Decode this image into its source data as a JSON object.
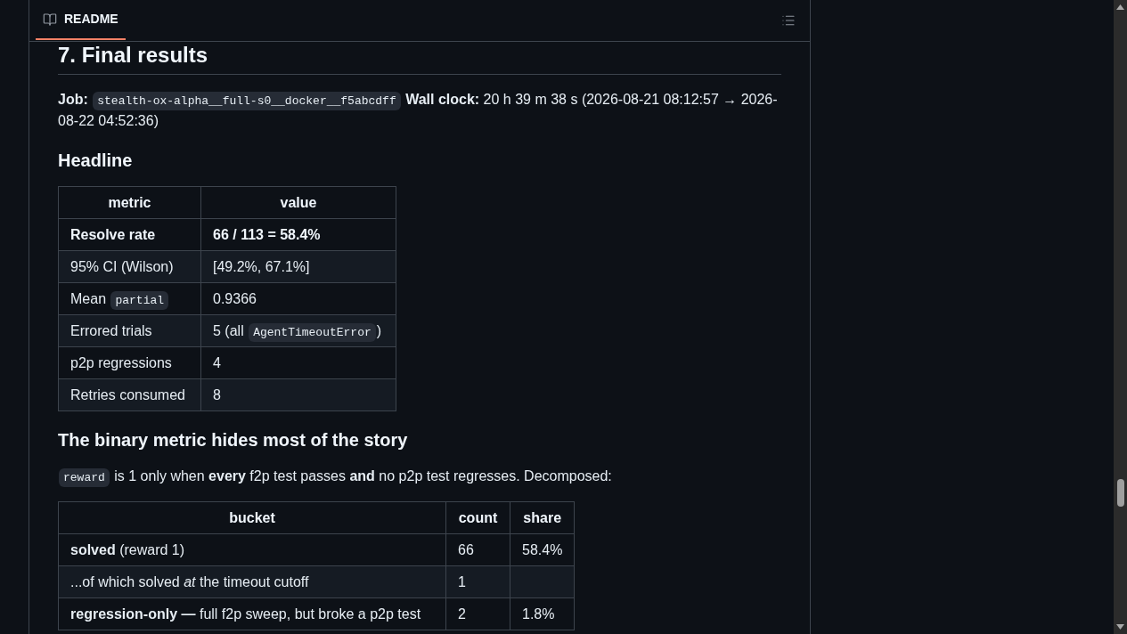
{
  "panel_header": {
    "tabs": [
      {
        "label": "README",
        "selected": true
      }
    ]
  },
  "content": [
    {
      "kind": "h2",
      "text": "7. Final results"
    },
    {
      "kind": "paragraph",
      "segments": [
        {
          "kind": "text",
          "text": "**Job:** "
        },
        {
          "kind": "code",
          "text": "stealth-ox-alpha__full-s0__docker__f5abcdff"
        },
        {
          "kind": "text",
          "text": " **Wall clock:** 20 h 39 m 38 s (2026-08-21 08:12:57 → 2026-08-22 04:52:36)"
        }
      ]
    },
    {
      "kind": "h3",
      "text": "Headline"
    },
    {
      "kind": "table",
      "columns": [
        {
          "label": "metric"
        },
        {
          "label": "value"
        }
      ],
      "rows": [
        {
          "bold": true,
          "cells": [
            [
              {
                "kind": "text",
                "text": "Resolve rate"
              }
            ],
            [
              {
                "kind": "text",
                "text": "66 / 113 = 58.4%"
              }
            ]
          ]
        },
        {
          "bold": false,
          "cells": [
            [
              {
                "kind": "text",
                "text": "95% CI (Wilson)"
              }
            ],
            [
              {
                "kind": "text",
                "text": "[49.2%, 67.1%]"
              }
            ]
          ]
        },
        {
          "bold": false,
          "cells": [
            [
              {
                "kind": "text",
                "text": "Mean "
              },
              {
                "kind": "code",
                "text": "partial"
              }
            ],
            [
              {
                "kind": "text",
                "text": "0.9366"
              }
            ]
          ]
        },
        {
          "bold": false,
          "cells": [
            [
              {
                "kind": "text",
                "text": "Errored trials"
              }
            ],
            [
              {
                "kind": "text",
                "text": "5 (all "
              },
              {
                "kind": "code",
                "text": "AgentTimeoutError"
              },
              {
                "kind": "text",
                "text": ")"
              }
            ]
          ]
        },
        {
          "bold": false,
          "cells": [
            [
              {
                "kind": "text",
                "text": "p2p regressions"
              }
            ],
            [
              {
                "kind": "text",
                "text": "4"
              }
            ]
          ]
        },
        {
          "bold": false,
          "cells": [
            [
              {
                "kind": "text",
                "text": "Retries consumed"
              }
            ],
            [
              {
                "kind": "text",
                "text": "8"
              }
            ]
          ]
        }
      ]
    },
    {
      "kind": "h3",
      "text": "The binary metric hides most of the story"
    },
    {
      "kind": "paragraph",
      "segments": [
        {
          "kind": "code",
          "text": "reward"
        },
        {
          "kind": "text",
          "text": " is 1 only when **every** f2p test passes **and** no p2p test regresses. Decomposed:"
        }
      ]
    },
    {
      "kind": "table",
      "columns": [
        {
          "label": "bucket"
        },
        {
          "label": "count"
        },
        {
          "label": "share"
        }
      ],
      "rows": [
        {
          "bold": false,
          "cells": [
            [
              {
                "kind": "text",
                "text": "**solved** (reward 1)"
              }
            ],
            [
              {
                "kind": "text",
                "text": "66"
              }
            ],
            [
              {
                "kind": "text",
                "text": "58.4%"
              }
            ]
          ]
        },
        {
          "bold": false,
          "cells": [
            [
              {
                "kind": "text",
                "text": "...of which solved *at* the timeout cutoff"
              }
            ],
            [
              {
                "kind": "text",
                "text": "1"
              }
            ]
          ]
        },
        {
          "bold": false,
          "cells": [
            [
              {
                "kind": "text",
                "text": "**regression-only —** full f2p sweep, but broke a p2p test"
              }
            ],
            [
              {
                "kind": "text",
                "text": "2"
              }
            ],
            [
              {
                "kind": "text",
                "text": "1.8%"
              }
            ]
          ]
        }
      ]
    }
  ]
}
